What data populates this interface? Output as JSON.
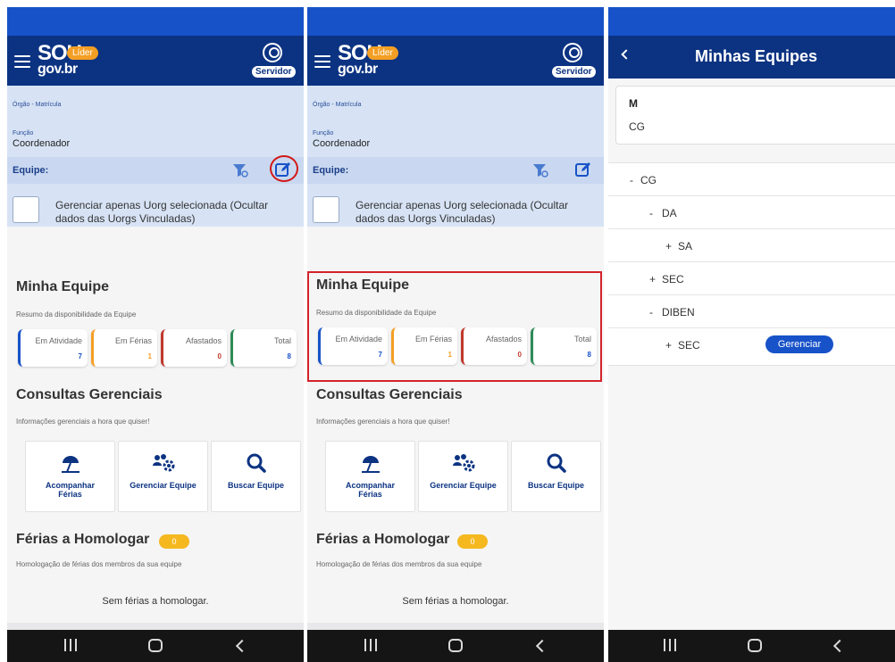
{
  "app": {
    "logo_top": "SOU",
    "logo_bottom": "gov.br",
    "lider_badge": "Líder",
    "servidor_label": "Servidor"
  },
  "info": {
    "orgao_label": "Órgão - Matrícula",
    "funcao_label": "Função",
    "funcao_value": "Coordenador",
    "equipe_label": "Equipe:",
    "checkbox_text": "Gerenciar apenas Uorg selecionada (Ocultar dados das Uorgs Vinculadas)"
  },
  "minha_equipe": {
    "title": "Minha Equipe",
    "subtitle": "Resumo da disponibilidade da Equipe",
    "stats": [
      {
        "label": "Em Atividade",
        "value": "7",
        "color": "#1752c8"
      },
      {
        "label": "Em Férias",
        "value": "1",
        "color": "#f49f24"
      },
      {
        "label": "Afastados",
        "value": "0",
        "color": "#c0392b"
      },
      {
        "label": "Total",
        "value": "8",
        "color": "#2e8b57"
      }
    ]
  },
  "consultas": {
    "title": "Consultas Gerenciais",
    "subtitle": "Informações gerenciais a hora que quiser!",
    "cards": [
      {
        "label_line1": "Acompanhar",
        "label_line2": "Férias",
        "icon": "beach-umbrella-icon"
      },
      {
        "label_line1": "Gerenciar Equipe",
        "label_line2": "",
        "icon": "team-gear-icon"
      },
      {
        "label_line1": "Buscar Equipe",
        "label_line2": "",
        "icon": "search-icon"
      }
    ]
  },
  "ferias": {
    "title": "Férias a Homologar",
    "badge": "0",
    "subtitle": "Homologação de férias dos membros da sua equipe",
    "empty_text": "Sem férias a homologar."
  },
  "minhas_equipes": {
    "title": "Minhas Equipes",
    "header_m": "M",
    "header_cg": "CG",
    "tree": [
      {
        "prefix": "-",
        "label": "CG",
        "level": 0
      },
      {
        "prefix": "-",
        "label": "DA",
        "level": 1
      },
      {
        "prefix": "+",
        "label": "SA",
        "level": 2
      },
      {
        "prefix": "+",
        "label": "SEC",
        "level": 1
      },
      {
        "prefix": "-",
        "label": "DIBEN",
        "level": 1
      },
      {
        "prefix": "+",
        "label": "SEC",
        "level": 2
      }
    ],
    "gerenciar_button": "Gerenciar"
  },
  "colors": {
    "appbar": "#0c3382",
    "statusbar": "#1752c8",
    "info_bg": "#d7e3f5",
    "badge_orange": "#f49f24",
    "highlight_red": "#d3232a"
  }
}
